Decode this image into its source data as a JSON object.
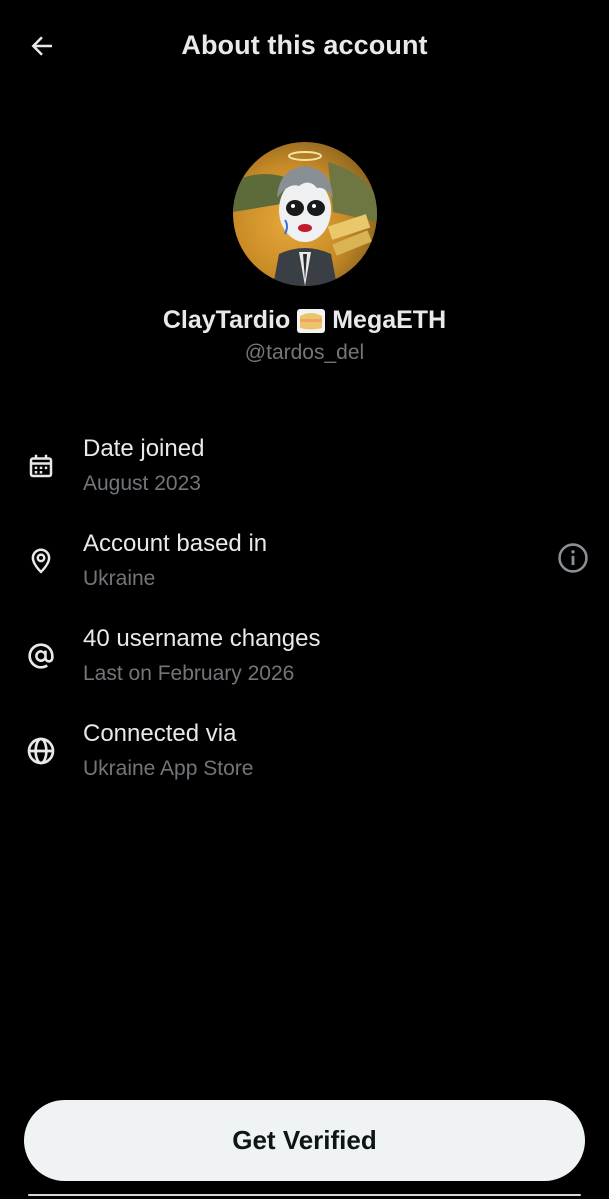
{
  "header": {
    "title": "About this account",
    "back_icon": "arrow-left-icon"
  },
  "profile": {
    "avatar_icon": "clay-character-avatar",
    "display_name_first": "ClayTardio",
    "display_name_emoji": "sandwich-emoji",
    "display_name_second": "MegaETH",
    "handle": "@tardos_del"
  },
  "info": {
    "items": [
      {
        "icon": "calendar-icon",
        "title": "Date joined",
        "subtitle": "August 2023"
      },
      {
        "icon": "location-pin-icon",
        "title": "Account based in",
        "subtitle": "Ukraine"
      },
      {
        "icon": "at-sign-icon",
        "title": "40 username changes",
        "subtitle": "Last on February 2026"
      },
      {
        "icon": "globe-icon",
        "title": "Connected via",
        "subtitle": "Ukraine App Store"
      }
    ],
    "info_button_icon": "info-circle-icon"
  },
  "cta": {
    "label": "Get Verified"
  },
  "colors": {
    "background": "#000000",
    "primary_text": "#e7e9ea",
    "secondary_text": "#71767b",
    "button_bg": "#eff3f4",
    "button_text": "#0f1419"
  }
}
